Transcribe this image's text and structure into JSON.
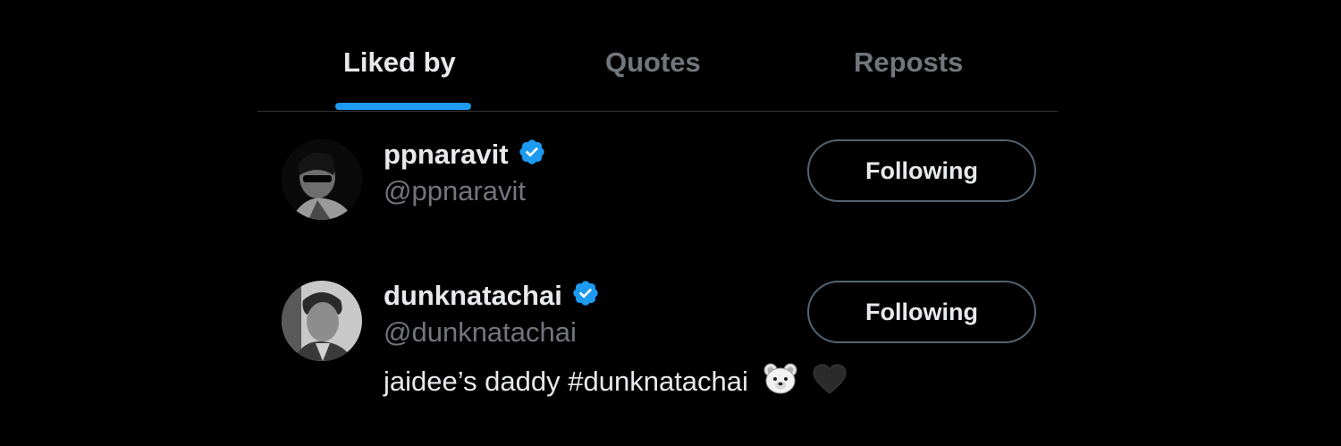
{
  "tabs": [
    {
      "label": "Liked by",
      "active": true
    },
    {
      "label": "Quotes",
      "active": false
    },
    {
      "label": "Reposts",
      "active": false
    }
  ],
  "users": [
    {
      "display_name": "ppnaravit",
      "handle": "@ppnaravit",
      "verified": true,
      "follow_label": "Following",
      "bio": ""
    },
    {
      "display_name": "dunknatachai",
      "handle": "@dunknatachai",
      "verified": true,
      "follow_label": "Following",
      "bio": "jaidee’s daddy #dunknatachai",
      "bio_emojis": [
        "bear-face-emoji",
        "black-heart-emoji"
      ]
    }
  ],
  "colors": {
    "background": "#000000",
    "text_primary": "#e7e9ea",
    "text_secondary": "#71767b",
    "accent": "#1d9bf0",
    "divider": "#2f3336",
    "button_border": "#536471"
  }
}
